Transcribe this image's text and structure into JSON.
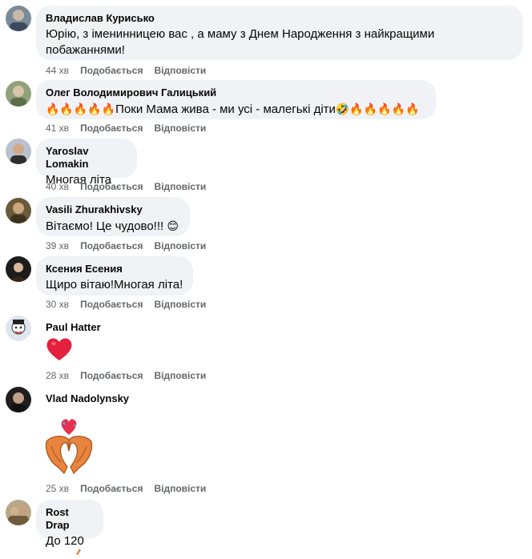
{
  "comments": [
    {
      "author": "Владислав Курисько",
      "text": "Юрію, з іменинницею вас , а маму з Днем Народження з найкращими побажаннями!",
      "time": "44 хв",
      "like": "Подобається",
      "reply": "Відповісти"
    },
    {
      "author": "Олег Володимирович Галицький",
      "text_prefix": "🔥🔥🔥🔥🔥",
      "text_main": "Поки Мама жива - ми усі - малегькі діти",
      "text_suffix": "🤣🔥🔥🔥🔥🔥",
      "time": "41 хв",
      "like": "Подобається",
      "reply": "Відповісти"
    },
    {
      "author": "Yaroslav Lomakin",
      "text": "Многая літа",
      "time": "40 хв",
      "like": "Подобається",
      "reply": "Відповісти"
    },
    {
      "author": "Vasili Zhurakhivsky",
      "text": "Вітаємо! Це чудово!!! ",
      "emoji": "😊",
      "time": "39 хв",
      "like": "Подобається",
      "reply": "Відповісти"
    },
    {
      "author": "Ксения Есения",
      "text": "Щиро вітаю!Многая літа!",
      "time": "30 хв",
      "like": "Подобається",
      "reply": "Відповісти"
    },
    {
      "author": "Paul Hatter",
      "sticker": "heart-emoji",
      "time": "28 хв",
      "like": "Подобається",
      "reply": "Відповісти"
    },
    {
      "author": "Vlad Nadolynsky",
      "sticker": "heart-hands-sticker",
      "time": "25 хв",
      "like": "Подобається",
      "reply": "Відповісти"
    },
    {
      "author": "Rost Drap",
      "text": "До 120"
    }
  ],
  "colors": {
    "bubble": "#f0f2f5",
    "meta": "#65676b",
    "heart": "#e0245e",
    "hands": "#e0803a"
  }
}
